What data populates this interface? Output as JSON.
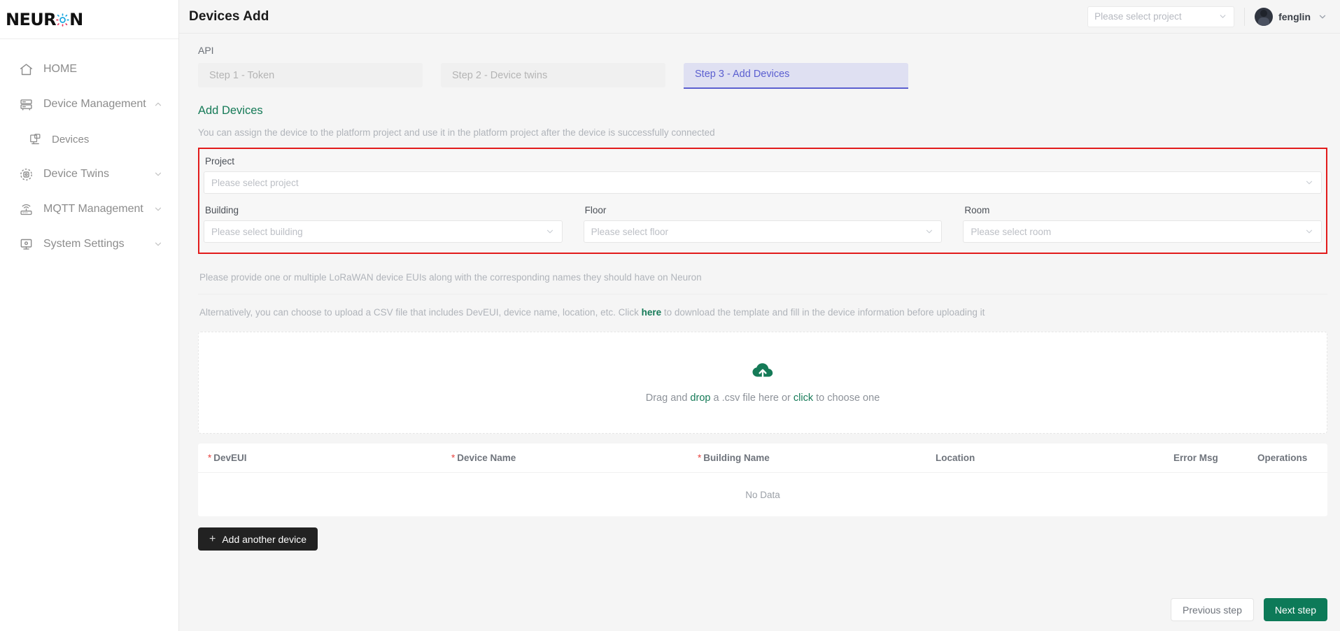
{
  "brand": {
    "logo_prefix": "NEUR",
    "logo_suffix": "N",
    "logo_icon": "gear-sun-icon",
    "accent_green": "#157a57",
    "accent_purple": "#5b5fd0",
    "highlight_red": "#e21b1b"
  },
  "sidebar": {
    "items": [
      {
        "label": "HOME",
        "icon": "home-icon",
        "expandable": false,
        "sub": false
      },
      {
        "label": "Device Management",
        "icon": "server-rack-icon",
        "expandable": true,
        "chevron": "chevron-up-icon",
        "sub": false
      },
      {
        "label": "Devices",
        "icon": "device-list-icon",
        "expandable": false,
        "sub": true
      },
      {
        "label": "Device Twins",
        "icon": "radar-circle-icon",
        "expandable": true,
        "chevron": "chevron-down-icon",
        "sub": false
      },
      {
        "label": "MQTT Management",
        "icon": "router-wifi-icon",
        "expandable": true,
        "chevron": "chevron-down-icon",
        "sub": false
      },
      {
        "label": "System Settings",
        "icon": "monitor-icon",
        "expandable": true,
        "chevron": "chevron-down-icon",
        "sub": false
      }
    ]
  },
  "topbar": {
    "title": "Devices Add",
    "project_select_placeholder": "Please select project",
    "project_select_value": "",
    "user_name": "fenglin",
    "user_chevron_icon": "chevron-down-icon",
    "avatar_icon": "avatar"
  },
  "content": {
    "api_label": "API",
    "steps": [
      {
        "label": "Step 1 - Token",
        "active": false
      },
      {
        "label": "Step 2 - Device twins",
        "active": false
      },
      {
        "label": "Step 3 - Add Devices",
        "active": true
      }
    ],
    "panel_title": "Add Devices",
    "panel_desc": "You can assign the device to the platform project and use it in the platform project after the device is successfully connected",
    "form": {
      "project": {
        "label": "Project",
        "placeholder": "Please select project",
        "value": ""
      },
      "building": {
        "label": "Building",
        "placeholder": "Please select building",
        "value": ""
      },
      "floor": {
        "label": "Floor",
        "placeholder": "Please select floor",
        "value": ""
      },
      "room": {
        "label": "Room",
        "placeholder": "Please select room",
        "value": ""
      }
    },
    "note_1": "Please provide one or multiple LoRaWAN device EUIs along with the corresponding names they should have on Neuron",
    "note_2_before": "Alternatively, you can choose to upload a CSV file that includes DevEUI, device name, location, etc. Click",
    "note_2_link": "here",
    "note_2_after": "to download the template and fill in the device information before uploading it",
    "dropzone": {
      "icon": "cloud-upload-icon",
      "text_1": "Drag and ",
      "text_drop": "drop",
      "text_2": " a .csv file here or ",
      "text_click": "click",
      "text_3": " to choose one"
    },
    "table": {
      "columns": [
        {
          "label": "DevEUI",
          "required": true
        },
        {
          "label": "Device Name",
          "required": true
        },
        {
          "label": "Building Name",
          "required": true
        },
        {
          "label": "Location",
          "required": false
        },
        {
          "label": "Error Msg",
          "required": false
        },
        {
          "label": "Operations",
          "required": false
        }
      ],
      "rows": [],
      "empty_text": "No Data"
    },
    "add_another_label": "Add another device",
    "add_another_icon": "plus-icon"
  },
  "footer": {
    "previous_label": "Previous step",
    "next_label": "Next step"
  }
}
